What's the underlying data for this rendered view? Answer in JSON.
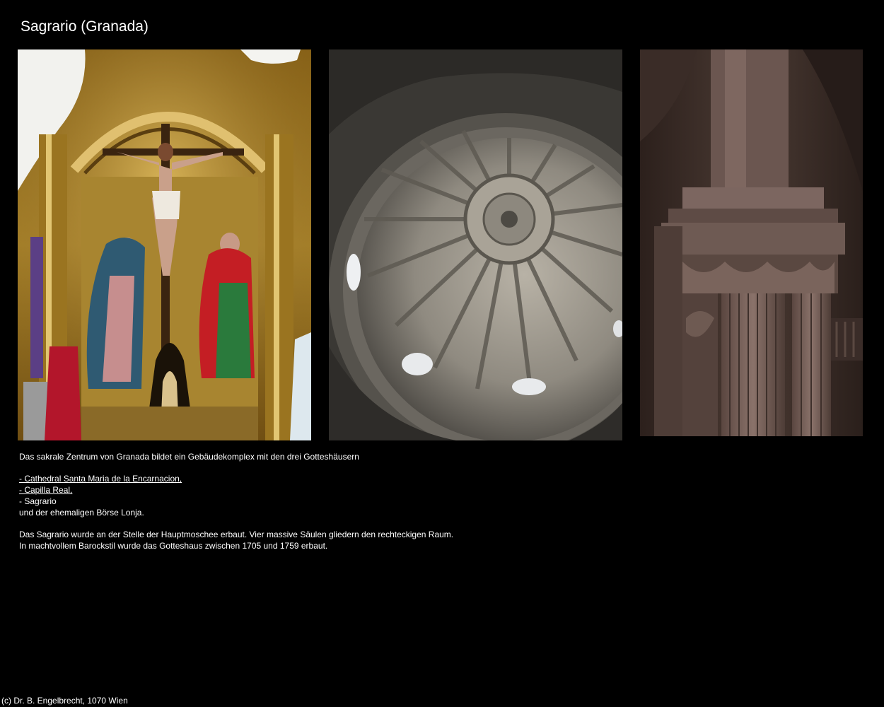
{
  "page": {
    "title": "Sagrario (Granada)"
  },
  "photos": [
    {
      "name": "altar-crucifixion-photo"
    },
    {
      "name": "dome-interior-photo"
    },
    {
      "name": "column-pillar-photo"
    }
  ],
  "description": {
    "intro": "Das sakrale Zentrum von Granada bildet ein Gebäudekomplex mit den drei Gotteshäusern",
    "links": [
      "- Cathedral Santa Maria de la Encarnacion,",
      "- Capilla Real,"
    ],
    "item_sagrario": "- Sagrario",
    "item_lonja": "und der ehemaligen Börse Lonja.",
    "para2_line1": "Das Sagrario wurde an der Stelle der Hauptmoschee erbaut. Vier massive Säulen gliedern den rechteckigen Raum.",
    "para2_line2": "In machtvollem Barockstil wurde das Gotteshaus zwischen 1705 und 1759 erbaut."
  },
  "footer": {
    "copyright": "(c) Dr. B. Engelbrecht, 1070 Wien"
  }
}
